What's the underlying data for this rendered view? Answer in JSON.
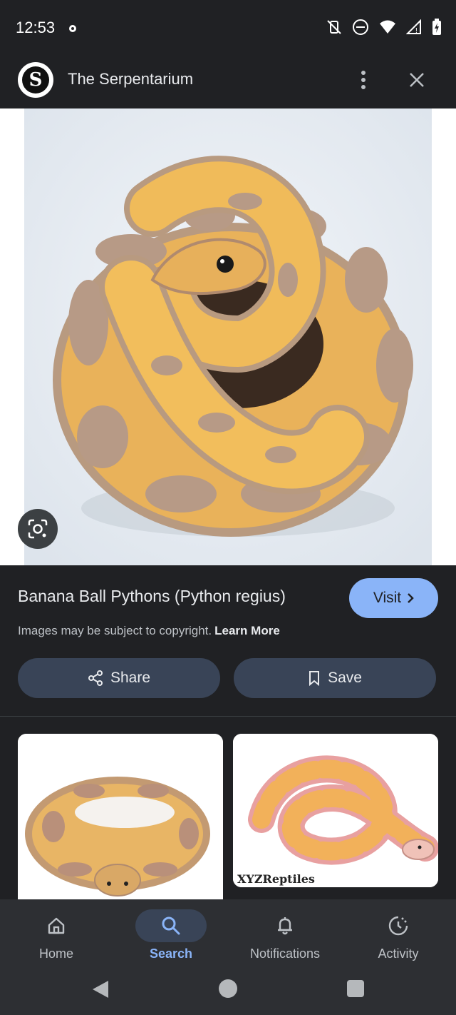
{
  "status_bar": {
    "time": "12:53"
  },
  "header": {
    "site_name": "The Serpentarium",
    "logo_letter": "S"
  },
  "result": {
    "title": "Banana Ball Pythons (Python regius)",
    "visit_label": "Visit",
    "copyright_text": "Images may be subject to copyright.",
    "learn_more_label": "Learn More",
    "share_label": "Share",
    "save_label": "Save"
  },
  "related": {
    "thumb2_watermark": "XYZReptiles",
    "thumb2_source": "XYZReptiles"
  },
  "bottom_nav": {
    "items": [
      {
        "label": "Home",
        "icon": "home-icon"
      },
      {
        "label": "Search",
        "icon": "search-icon",
        "active": true
      },
      {
        "label": "Notifications",
        "icon": "bell-icon"
      },
      {
        "label": "Activity",
        "icon": "activity-icon"
      }
    ]
  },
  "colors": {
    "background": "#202124",
    "accent": "#8ab4f8",
    "button_bg": "#394457",
    "nav_bg": "#2d2f33",
    "snake_yellow": "#f0b448",
    "snake_lavender": "#b79a86"
  }
}
